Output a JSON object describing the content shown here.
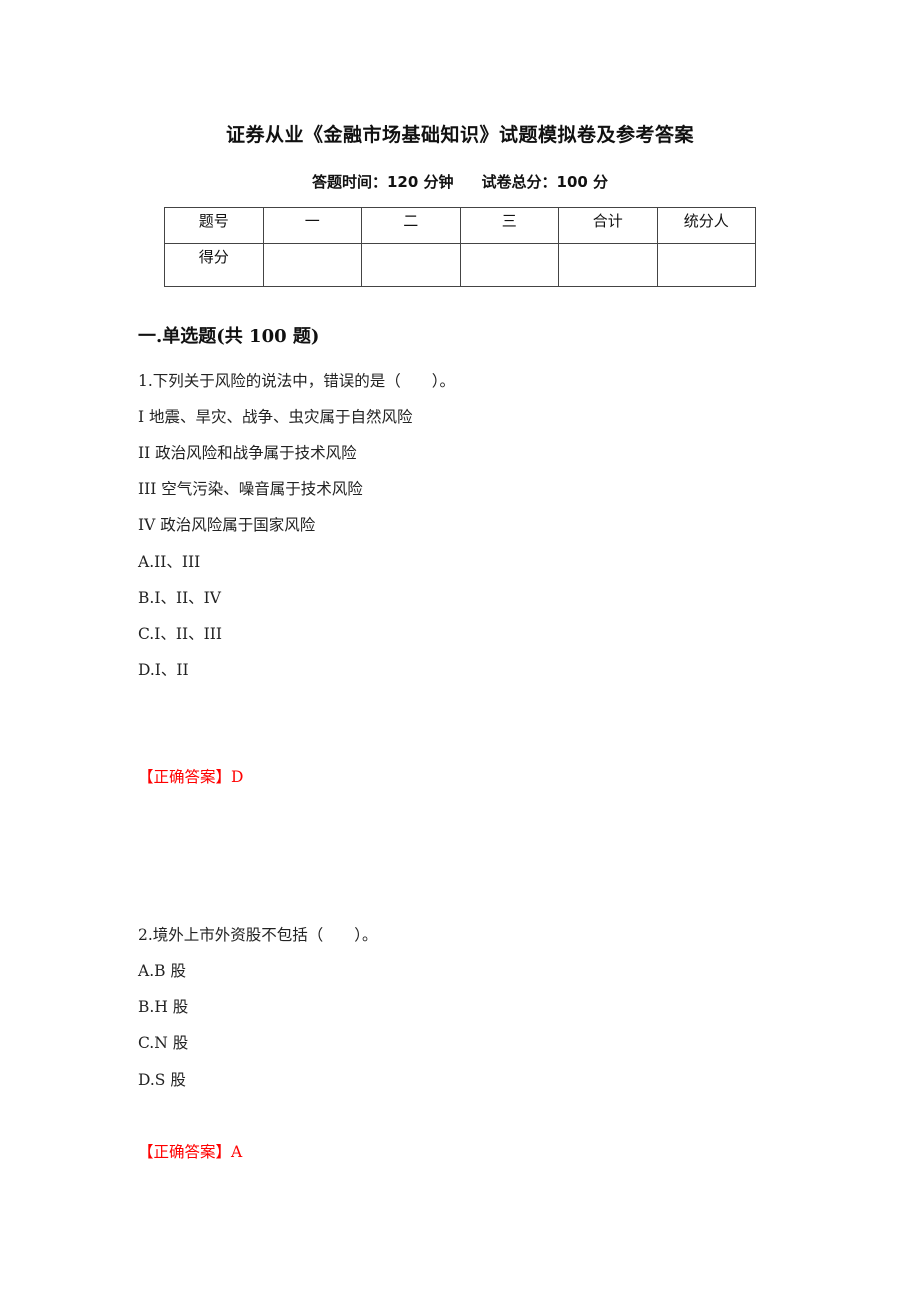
{
  "header": {
    "title": "证券从业《金融市场基础知识》试题模拟卷及参考答案",
    "time_label": "答题时间：120 分钟",
    "total_label": "试卷总分：100 分"
  },
  "score_table": {
    "header_row": [
      "题号",
      "一",
      "二",
      "三",
      "合计",
      "统分人"
    ],
    "score_row": [
      "得分",
      "",
      "",
      "",
      "",
      ""
    ]
  },
  "section": {
    "title": "一.单选题(共 100 题)"
  },
  "questions": [
    {
      "stem": "1.下列关于风险的说法中，错误的是（　　）。",
      "statements": [
        "I 地震、旱灾、战争、虫灾属于自然风险",
        "II 政治风险和战争属于技术风险",
        "III 空气污染、噪音属于技术风险",
        "IV 政治风险属于国家风险"
      ],
      "options": [
        "A.II、III",
        "B.I、II、IV",
        "C.I、II、III",
        "D.I、II"
      ],
      "answer_label": "【正确答案】D"
    },
    {
      "stem": "2.境外上市外资股不包括（　　）。",
      "statements": [],
      "options": [
        "A.B 股",
        "B.H 股",
        "C.N 股",
        "D.S 股"
      ],
      "answer_label": "【正确答案】A"
    }
  ],
  "colors": {
    "answer": "#ff0000",
    "text": "#222222"
  }
}
